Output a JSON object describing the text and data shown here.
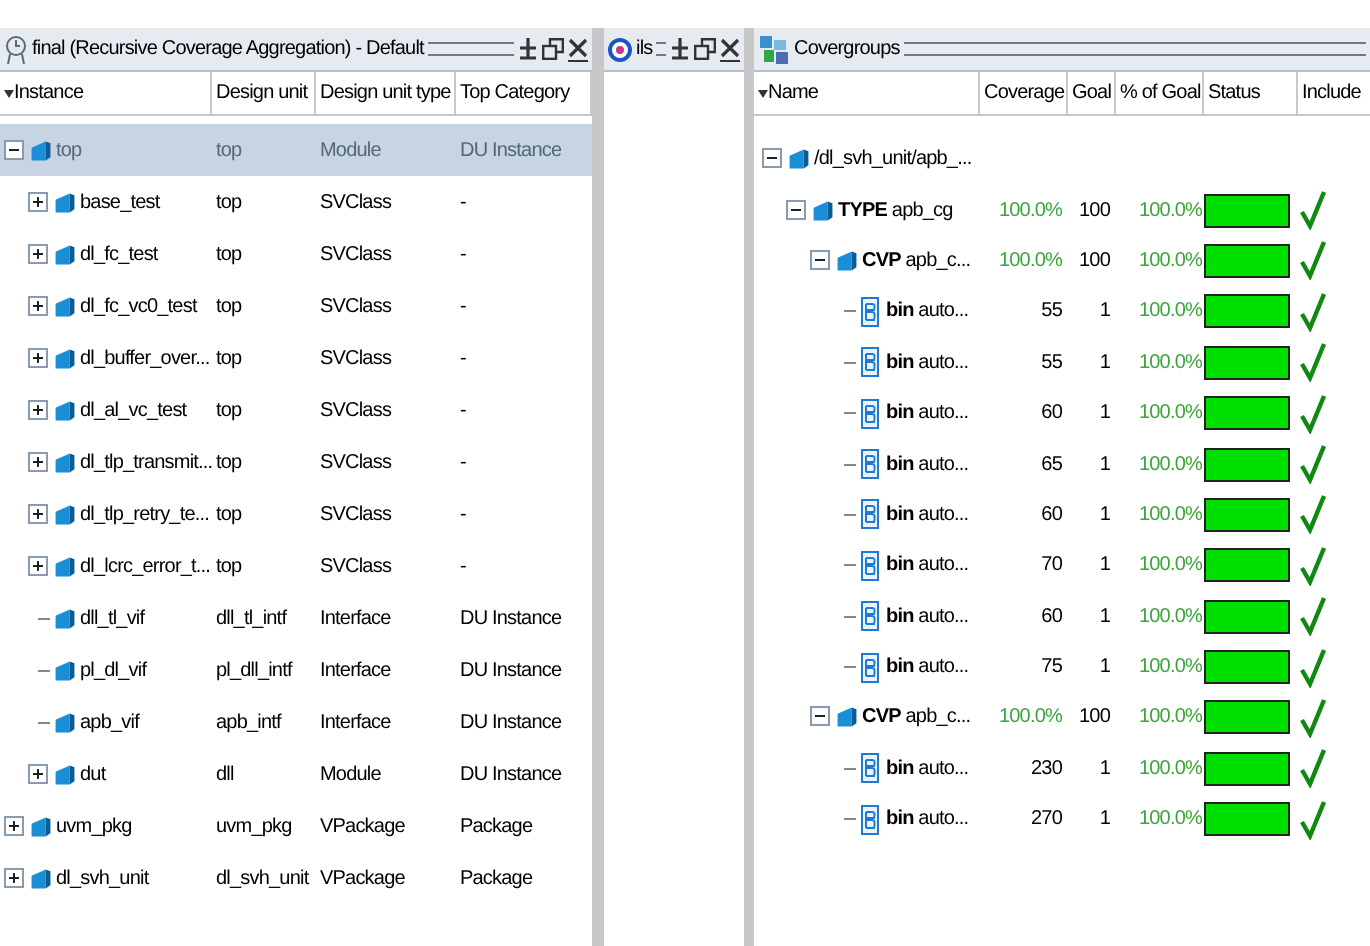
{
  "instance_panel": {
    "title": "final (Recursive Coverage Aggregation) - Default",
    "columns": [
      "Instance",
      "Design unit",
      "Design unit type",
      "Top Category"
    ],
    "rows": [
      {
        "name": "top",
        "design_unit": "top",
        "type": "Module",
        "category": "DU Instance",
        "expanded": true,
        "selected": true,
        "children": [
          {
            "name": "base_test",
            "design_unit": "top",
            "type": "SVClass",
            "category": "-",
            "expanded": false,
            "selected": false
          },
          {
            "name": "dl_fc_test",
            "design_unit": "top",
            "type": "SVClass",
            "category": "-",
            "expanded": false,
            "selected": false
          },
          {
            "name": "dl_fc_vc0_test",
            "design_unit": "top",
            "type": "SVClass",
            "category": "-",
            "expanded": false,
            "selected": false
          },
          {
            "name": "dl_buffer_over...",
            "design_unit": "top",
            "type": "SVClass",
            "category": "-",
            "expanded": false,
            "selected": false
          },
          {
            "name": "dl_al_vc_test",
            "design_unit": "top",
            "type": "SVClass",
            "category": "-",
            "expanded": false,
            "selected": false
          },
          {
            "name": "dl_tlp_transmit...",
            "design_unit": "top",
            "type": "SVClass",
            "category": "-",
            "expanded": false,
            "selected": false
          },
          {
            "name": "dl_tlp_retry_te...",
            "design_unit": "top",
            "type": "SVClass",
            "category": "-",
            "expanded": false,
            "selected": false
          },
          {
            "name": "dl_lcrc_error_t...",
            "design_unit": "top",
            "type": "SVClass",
            "category": "-",
            "expanded": false,
            "selected": false
          },
          {
            "name": "dll_tl_vif",
            "design_unit": "dll_tl_intf",
            "type": "Interface",
            "category": "DU Instance",
            "selected": false
          },
          {
            "name": "pl_dl_vif",
            "design_unit": "pl_dll_intf",
            "type": "Interface",
            "category": "DU Instance",
            "selected": false
          },
          {
            "name": "apb_vif",
            "design_unit": "apb_intf",
            "type": "Interface",
            "category": "DU Instance",
            "selected": false
          },
          {
            "name": "dut",
            "design_unit": "dll",
            "type": "Module",
            "category": "DU Instance",
            "expanded": false,
            "selected": false
          }
        ]
      },
      {
        "name": "uvm_pkg",
        "design_unit": "uvm_pkg",
        "type": "VPackage",
        "category": "Package",
        "expanded": false,
        "selected": false
      },
      {
        "name": "dl_svh_unit",
        "design_unit": "dl_svh_unit",
        "type": "VPackage",
        "category": "Package",
        "expanded": false,
        "selected": false
      }
    ]
  },
  "ils_panel": {
    "title": "ils"
  },
  "covergroups_panel": {
    "title": "Covergroups",
    "columns": [
      "Name",
      "Coverage",
      "Goal",
      "% of Goal",
      "Status",
      "Include"
    ],
    "rows": [
      {
        "kind": "path",
        "name": "/dl_svh_unit/apb_...",
        "expanded": true,
        "children": [
          {
            "kind": "type",
            "name": "**TYPE** apb_cg",
            "coverage": "100.0%",
            "goal": "100",
            "percent_of_goal": "100.0%",
            "level": 1,
            "included": true,
            "expanded": true,
            "children": [
              {
                "kind": "coverpoint",
                "name": "**CVP** apb_c...",
                "coverage": "100.0%",
                "goal": "100",
                "percent_of_goal": "100.0%",
                "level": 1,
                "included": true,
                "expanded": true,
                "children": [
                  {
                    "kind": "bin",
                    "name": "**bin** auto...",
                    "coverage": "55",
                    "goal": "1",
                    "percent_of_goal": "100.0%",
                    "level": 1,
                    "included": true
                  },
                  {
                    "kind": "bin",
                    "name": "**bin** auto...",
                    "coverage": "55",
                    "goal": "1",
                    "percent_of_goal": "100.0%",
                    "level": 1,
                    "included": true
                  },
                  {
                    "kind": "bin",
                    "name": "**bin** auto...",
                    "coverage": "60",
                    "goal": "1",
                    "percent_of_goal": "100.0%",
                    "level": 1,
                    "included": true
                  },
                  {
                    "kind": "bin",
                    "name": "**bin** auto...",
                    "coverage": "65",
                    "goal": "1",
                    "percent_of_goal": "100.0%",
                    "level": 1,
                    "included": true
                  },
                  {
                    "kind": "bin",
                    "name": "**bin** auto...",
                    "coverage": "60",
                    "goal": "1",
                    "percent_of_goal": "100.0%",
                    "level": 1,
                    "included": true
                  },
                  {
                    "kind": "bin",
                    "name": "**bin** auto...",
                    "coverage": "70",
                    "goal": "1",
                    "percent_of_goal": "100.0%",
                    "level": 1,
                    "included": true
                  },
                  {
                    "kind": "bin",
                    "name": "**bin** auto...",
                    "coverage": "60",
                    "goal": "1",
                    "percent_of_goal": "100.0%",
                    "level": 1,
                    "included": true
                  },
                  {
                    "kind": "bin",
                    "name": "**bin** auto...",
                    "coverage": "75",
                    "goal": "1",
                    "percent_of_goal": "100.0%",
                    "level": 1,
                    "included": true
                  }
                ]
              },
              {
                "kind": "coverpoint",
                "name": "**CVP** apb_c...",
                "coverage": "100.0%",
                "goal": "100",
                "percent_of_goal": "100.0%",
                "level": 1,
                "included": true,
                "expanded": true,
                "children": [
                  {
                    "kind": "bin",
                    "name": "**bin** auto...",
                    "coverage": "230",
                    "goal": "1",
                    "percent_of_goal": "100.0%",
                    "level": 1,
                    "included": true
                  },
                  {
                    "kind": "bin",
                    "name": "**bin** auto...",
                    "coverage": "270",
                    "goal": "1",
                    "percent_of_goal": "100.0%",
                    "level": 1,
                    "included": true
                  }
                ]
              }
            ]
          }
        ]
      }
    ]
  }
}
